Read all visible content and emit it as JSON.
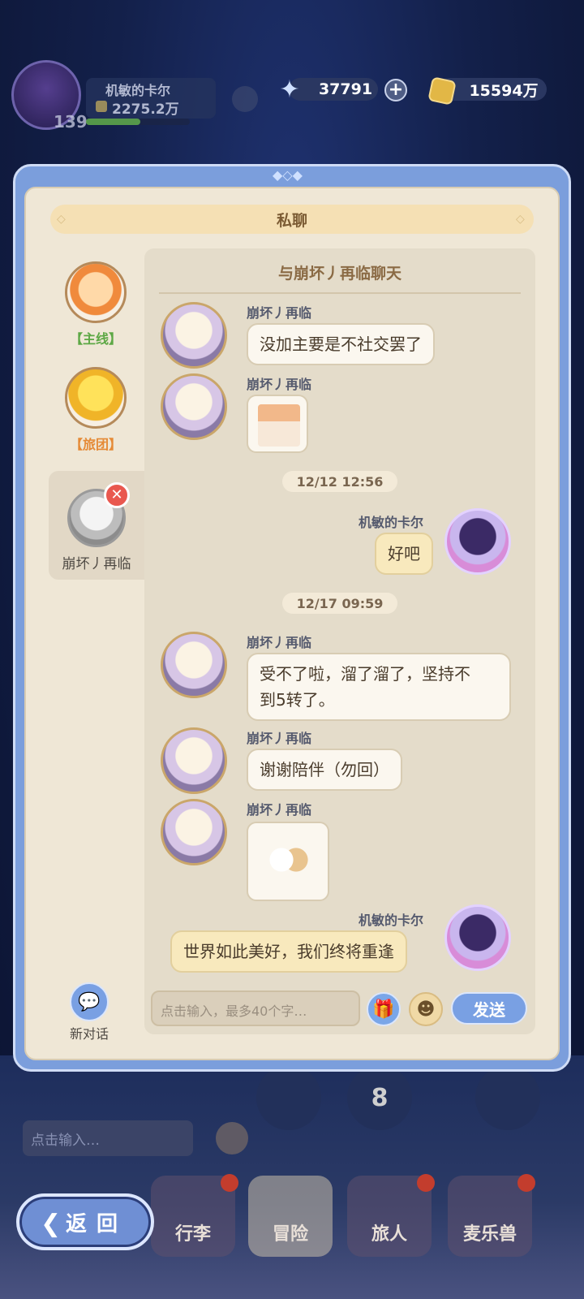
{
  "hud": {
    "player_name": "机敏的卡尔",
    "power": "2275.2万",
    "level": "139",
    "gems": "37791",
    "gold": "15594万"
  },
  "dialog": {
    "title": "私聊",
    "chat_title": "与崩坏丿再临聊天"
  },
  "sidebar": {
    "items": [
      {
        "label": "【主线】",
        "color": "#5da845"
      },
      {
        "label": "【旅团】",
        "color": "#e58a36"
      },
      {
        "label": "崩坏丿再临"
      }
    ],
    "new_chat_label": "新对话"
  },
  "messages": [
    {
      "sender": "崩坏丿再临",
      "text": "没加主要是不社交罢了"
    },
    {
      "sender": "崩坏丿再临",
      "sticker": "dog-sticker"
    },
    {
      "time": "12/12  12:56"
    },
    {
      "sender": "机敏的卡尔",
      "text": "好吧"
    },
    {
      "time": "12/17  09:59"
    },
    {
      "sender": "崩坏丿再临",
      "text_line1": "受不了啦，溜了溜了，坚持不",
      "text_line2": "到5转了。"
    },
    {
      "sender": "崩坏丿再临",
      "text": "谢谢陪伴（勿回）"
    },
    {
      "sender": "崩坏丿再临",
      "sticker": "hug-sticker"
    },
    {
      "sender": "机敏的卡尔",
      "text": "世界如此美好，我们终将重逢"
    }
  ],
  "composer": {
    "placeholder": "点击输入，最多40个字…",
    "send_label": "发送"
  },
  "background": {
    "input_placeholder": "点击输入…",
    "tabs": [
      "行李",
      "冒险",
      "旅人",
      "麦乐兽"
    ],
    "badge_number": "8",
    "back_label": "返回"
  },
  "colors": {
    "accent_blue": "#7b9edc",
    "parchment": "#efe7d6",
    "my_bubble": "#f8e9bd"
  }
}
